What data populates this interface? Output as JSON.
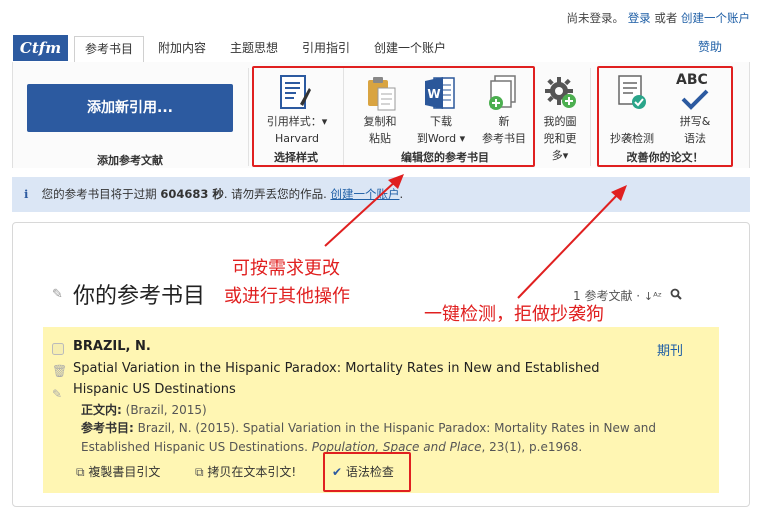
{
  "account": {
    "status": "尚未登录。",
    "login": "登录",
    "or": "或者",
    "create": "创建一个账户"
  },
  "logo": "Ctfm",
  "nav": {
    "tabs": [
      "参考书目",
      "附加内容",
      "主题思想",
      "引用指引",
      "创建一个账户"
    ],
    "help": "赞助"
  },
  "ribbon": {
    "add_button": "添加新引用...",
    "add_group_label": "添加参考文献",
    "style_label_line1": "引用样式：▾",
    "style_label_line2": "Harvard",
    "style_group_label": "选择样式",
    "copy_line1": "复制和",
    "copy_line2": "粘贴",
    "download_line1": "下载",
    "download_line2": "到Word ▾",
    "new_line1": "新",
    "new_line2": "参考书目",
    "edit_group_label": "编辑您的参考书目",
    "more_line1": "我的圖",
    "more_line2": "兜和更",
    "more_line3": "多▾",
    "plagiarism_label": "抄袭检测",
    "grammar_line1": "拼写&",
    "grammar_line2": "语法",
    "improve_group_label": "改善你的论文！",
    "abc": "ABC"
  },
  "info_bar": {
    "prefix": "您的参考书目将于过期",
    "seconds": "604683 秒",
    "middle": ". 请勿弄丢您的作品.",
    "link": "创建一个账户",
    "suffix": "."
  },
  "bibliography": {
    "title": "你的参考书目",
    "count": "1 参考文献 ·"
  },
  "reference": {
    "author": "BRAZIL, N.",
    "title": "Spatial Variation in the Hispanic Paradox: Mortality Rates in New and Established Hispanic US Destinations",
    "type": "期刊",
    "in_text_label": "正文内:",
    "in_text_value": "(Brazil, 2015)",
    "bib_label": "参考书目:",
    "bib_value_plain": "Brazil, N. (2015). Spatial Variation in the Hispanic Paradox: Mortality Rates in New and Established Hispanic US Destinations.",
    "bib_journal": "Population, Space and Place",
    "bib_tail": ", 23(1), p.e1968.",
    "action_copy_bib": "複製書目引文",
    "action_copy_text": "拷贝在文本引文!",
    "action_grammar": "语法检查"
  },
  "annotations": {
    "left_line1": "可按需求更改",
    "left_line2": "或进行其他操作",
    "right": "一键检测，拒做抄袭狗"
  },
  "colors": {
    "brand_blue": "#2c5aa0",
    "link_blue": "#1f5fa6",
    "annotation_red": "#e02020",
    "info_bg": "#dbe6f5",
    "card_bg": "#fff6b3"
  }
}
